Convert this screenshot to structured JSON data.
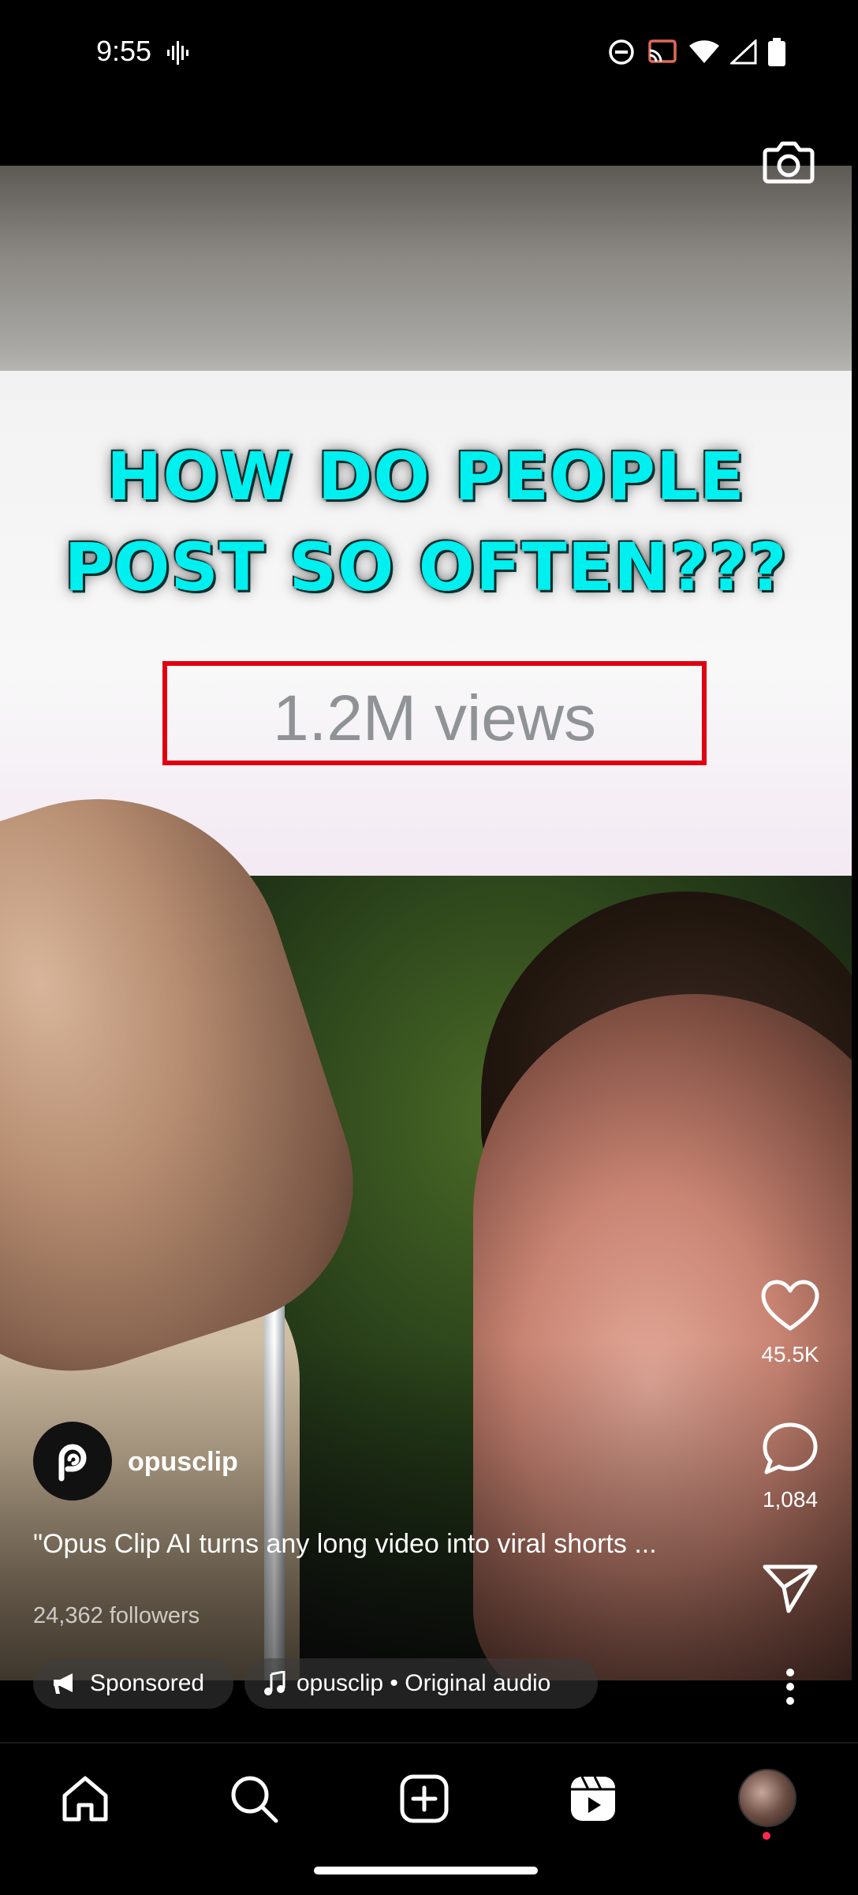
{
  "status": {
    "time": "9:55",
    "icons": [
      "sound-wave-icon",
      "do-not-disturb-icon",
      "cast-icon",
      "wifi-icon",
      "signal-icon",
      "battery-icon"
    ]
  },
  "video": {
    "headline_line1": "HOW DO PEOPLE",
    "headline_line2": "POST SO OFTEN???",
    "views_text": "1.2M views",
    "headline_color": "#00F0F0",
    "box_color": "#E00012"
  },
  "actions": {
    "likes": "45.5K",
    "comments": "1,084"
  },
  "post": {
    "username": "opusclip",
    "caption": "\"Opus Clip AI turns any long video into viral shorts ...",
    "followers": "24,362 followers",
    "sponsored_label": "Sponsored",
    "audio_label": "opusclip • Original audio"
  },
  "nav": {
    "items": [
      "home-icon",
      "search-icon",
      "create-icon",
      "reels-icon",
      "profile-avatar"
    ]
  }
}
